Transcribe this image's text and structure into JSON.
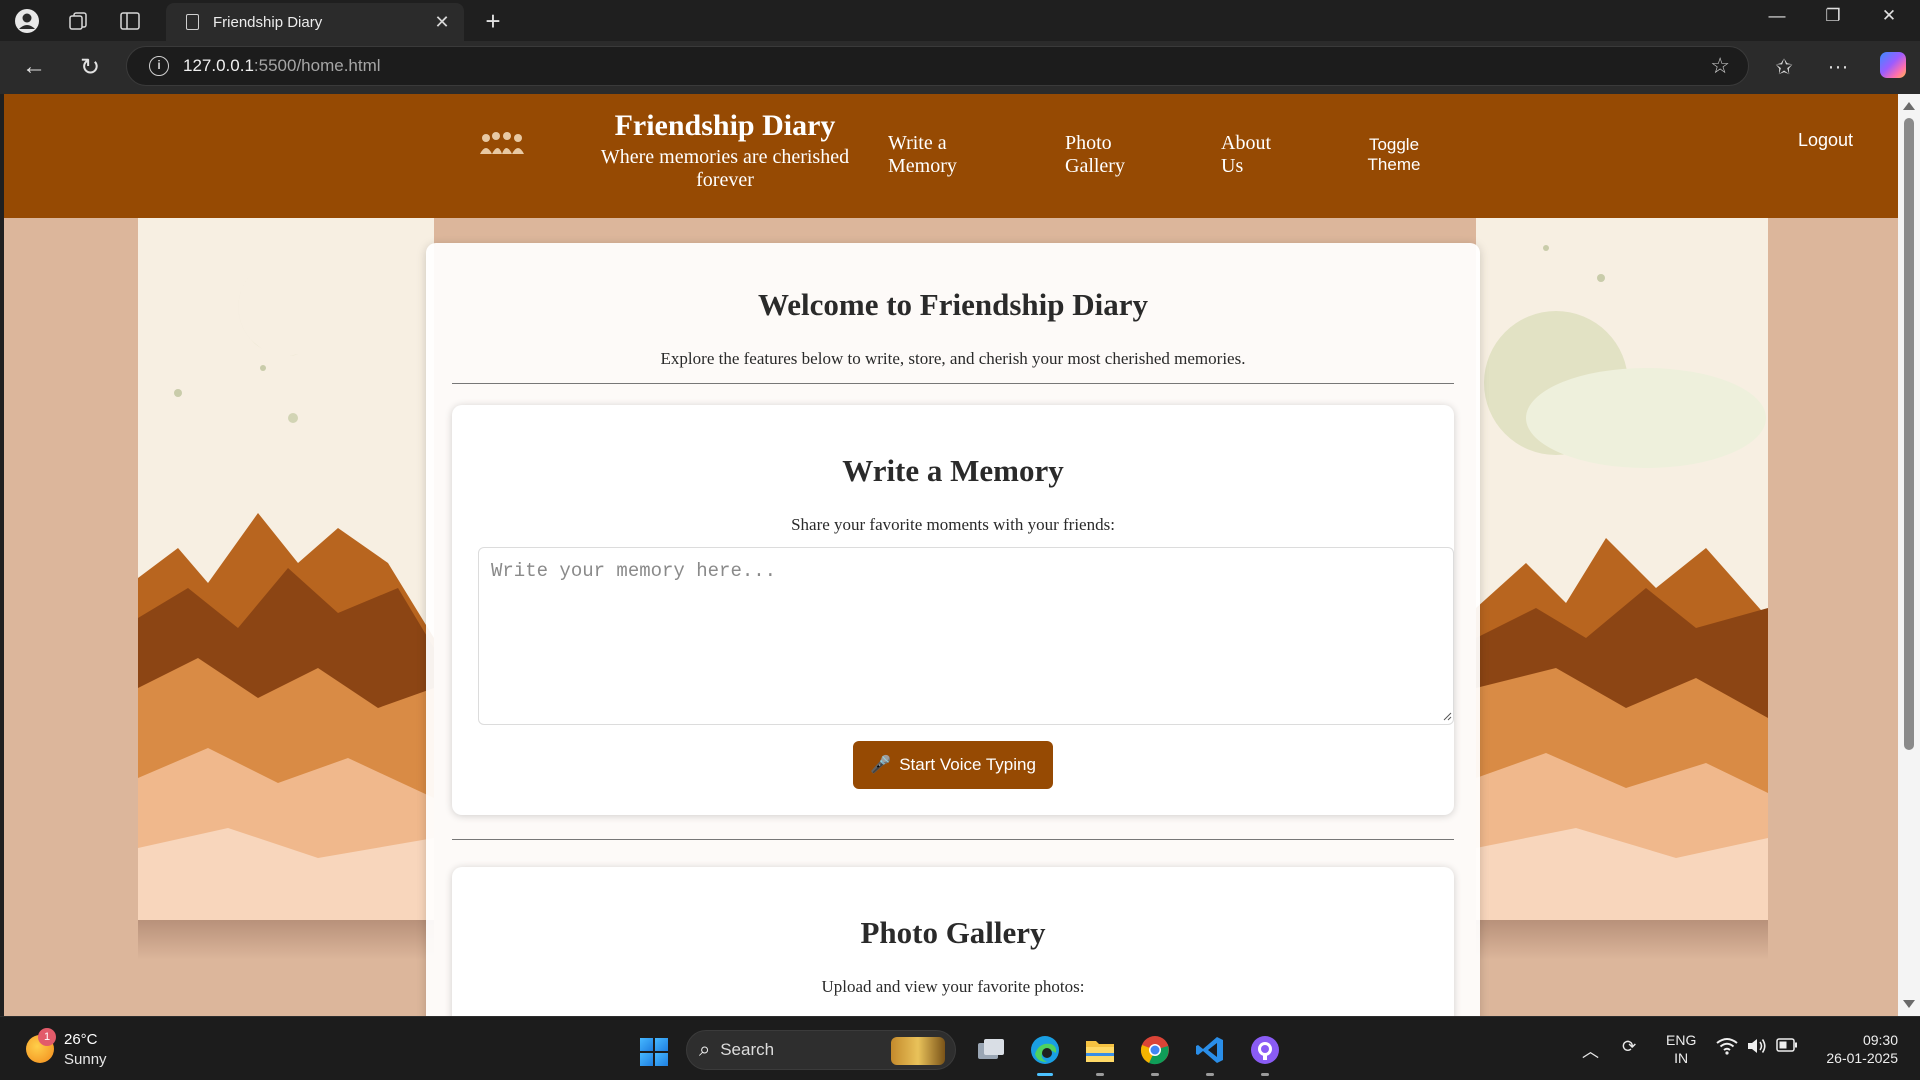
{
  "browser": {
    "tab_title": "Friendship Diary",
    "url_host": "127.0.0.1",
    "url_path": ":5500/home.html"
  },
  "header": {
    "title": "Friendship Diary",
    "tagline": "Where memories are cherished forever",
    "nav": [
      {
        "label": "Write a Memory"
      },
      {
        "label": "Photo Gallery"
      },
      {
        "label": "About Us"
      }
    ],
    "toggle_label": "Toggle Theme",
    "logout_label": "Logout"
  },
  "welcome": {
    "title": "Welcome to Friendship Diary",
    "subtitle": "Explore the features below to write, store, and cherish your most cherished memories."
  },
  "write_memory": {
    "title": "Write a Memory",
    "description": "Share your favorite moments with your friends:",
    "placeholder": "Write your memory here...",
    "voice_button": "Start Voice Typing",
    "voice_icon": "microphone-icon"
  },
  "photo_gallery": {
    "title": "Photo Gallery",
    "description": "Upload and view your favorite photos:"
  },
  "taskbar": {
    "weather_temp": "26°C",
    "weather_condition": "Sunny",
    "weather_badge": "1",
    "search_label": "Search",
    "language_line1": "ENG",
    "language_line2": "IN",
    "time": "09:30",
    "date": "26-01-2025"
  },
  "colors": {
    "brand_brown": "#964a03",
    "page_background": "#dcb69b"
  }
}
